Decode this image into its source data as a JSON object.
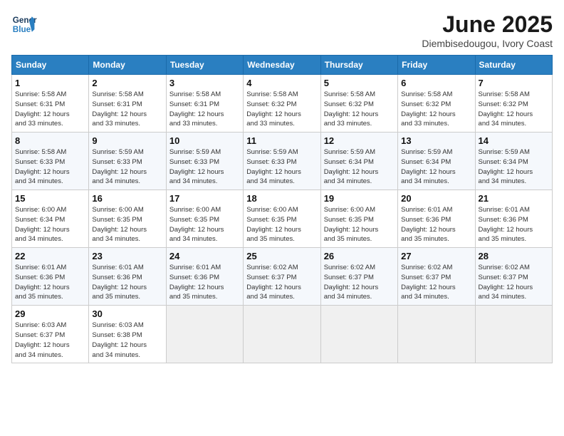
{
  "logo": {
    "line1": "General",
    "line2": "Blue"
  },
  "calendar": {
    "title": "June 2025",
    "subtitle": "Diembisedougou, Ivory Coast",
    "days_of_week": [
      "Sunday",
      "Monday",
      "Tuesday",
      "Wednesday",
      "Thursday",
      "Friday",
      "Saturday"
    ],
    "weeks": [
      [
        {
          "day": "1",
          "info": "Sunrise: 5:58 AM\nSunset: 6:31 PM\nDaylight: 12 hours\nand 33 minutes."
        },
        {
          "day": "2",
          "info": "Sunrise: 5:58 AM\nSunset: 6:31 PM\nDaylight: 12 hours\nand 33 minutes."
        },
        {
          "day": "3",
          "info": "Sunrise: 5:58 AM\nSunset: 6:31 PM\nDaylight: 12 hours\nand 33 minutes."
        },
        {
          "day": "4",
          "info": "Sunrise: 5:58 AM\nSunset: 6:32 PM\nDaylight: 12 hours\nand 33 minutes."
        },
        {
          "day": "5",
          "info": "Sunrise: 5:58 AM\nSunset: 6:32 PM\nDaylight: 12 hours\nand 33 minutes."
        },
        {
          "day": "6",
          "info": "Sunrise: 5:58 AM\nSunset: 6:32 PM\nDaylight: 12 hours\nand 33 minutes."
        },
        {
          "day": "7",
          "info": "Sunrise: 5:58 AM\nSunset: 6:32 PM\nDaylight: 12 hours\nand 34 minutes."
        }
      ],
      [
        {
          "day": "8",
          "info": "Sunrise: 5:58 AM\nSunset: 6:33 PM\nDaylight: 12 hours\nand 34 minutes."
        },
        {
          "day": "9",
          "info": "Sunrise: 5:59 AM\nSunset: 6:33 PM\nDaylight: 12 hours\nand 34 minutes."
        },
        {
          "day": "10",
          "info": "Sunrise: 5:59 AM\nSunset: 6:33 PM\nDaylight: 12 hours\nand 34 minutes."
        },
        {
          "day": "11",
          "info": "Sunrise: 5:59 AM\nSunset: 6:33 PM\nDaylight: 12 hours\nand 34 minutes."
        },
        {
          "day": "12",
          "info": "Sunrise: 5:59 AM\nSunset: 6:34 PM\nDaylight: 12 hours\nand 34 minutes."
        },
        {
          "day": "13",
          "info": "Sunrise: 5:59 AM\nSunset: 6:34 PM\nDaylight: 12 hours\nand 34 minutes."
        },
        {
          "day": "14",
          "info": "Sunrise: 5:59 AM\nSunset: 6:34 PM\nDaylight: 12 hours\nand 34 minutes."
        }
      ],
      [
        {
          "day": "15",
          "info": "Sunrise: 6:00 AM\nSunset: 6:34 PM\nDaylight: 12 hours\nand 34 minutes."
        },
        {
          "day": "16",
          "info": "Sunrise: 6:00 AM\nSunset: 6:35 PM\nDaylight: 12 hours\nand 34 minutes."
        },
        {
          "day": "17",
          "info": "Sunrise: 6:00 AM\nSunset: 6:35 PM\nDaylight: 12 hours\nand 34 minutes."
        },
        {
          "day": "18",
          "info": "Sunrise: 6:00 AM\nSunset: 6:35 PM\nDaylight: 12 hours\nand 35 minutes."
        },
        {
          "day": "19",
          "info": "Sunrise: 6:00 AM\nSunset: 6:35 PM\nDaylight: 12 hours\nand 35 minutes."
        },
        {
          "day": "20",
          "info": "Sunrise: 6:01 AM\nSunset: 6:36 PM\nDaylight: 12 hours\nand 35 minutes."
        },
        {
          "day": "21",
          "info": "Sunrise: 6:01 AM\nSunset: 6:36 PM\nDaylight: 12 hours\nand 35 minutes."
        }
      ],
      [
        {
          "day": "22",
          "info": "Sunrise: 6:01 AM\nSunset: 6:36 PM\nDaylight: 12 hours\nand 35 minutes."
        },
        {
          "day": "23",
          "info": "Sunrise: 6:01 AM\nSunset: 6:36 PM\nDaylight: 12 hours\nand 35 minutes."
        },
        {
          "day": "24",
          "info": "Sunrise: 6:01 AM\nSunset: 6:36 PM\nDaylight: 12 hours\nand 35 minutes."
        },
        {
          "day": "25",
          "info": "Sunrise: 6:02 AM\nSunset: 6:37 PM\nDaylight: 12 hours\nand 34 minutes."
        },
        {
          "day": "26",
          "info": "Sunrise: 6:02 AM\nSunset: 6:37 PM\nDaylight: 12 hours\nand 34 minutes."
        },
        {
          "day": "27",
          "info": "Sunrise: 6:02 AM\nSunset: 6:37 PM\nDaylight: 12 hours\nand 34 minutes."
        },
        {
          "day": "28",
          "info": "Sunrise: 6:02 AM\nSunset: 6:37 PM\nDaylight: 12 hours\nand 34 minutes."
        }
      ],
      [
        {
          "day": "29",
          "info": "Sunrise: 6:03 AM\nSunset: 6:37 PM\nDaylight: 12 hours\nand 34 minutes."
        },
        {
          "day": "30",
          "info": "Sunrise: 6:03 AM\nSunset: 6:38 PM\nDaylight: 12 hours\nand 34 minutes."
        },
        null,
        null,
        null,
        null,
        null
      ]
    ]
  }
}
